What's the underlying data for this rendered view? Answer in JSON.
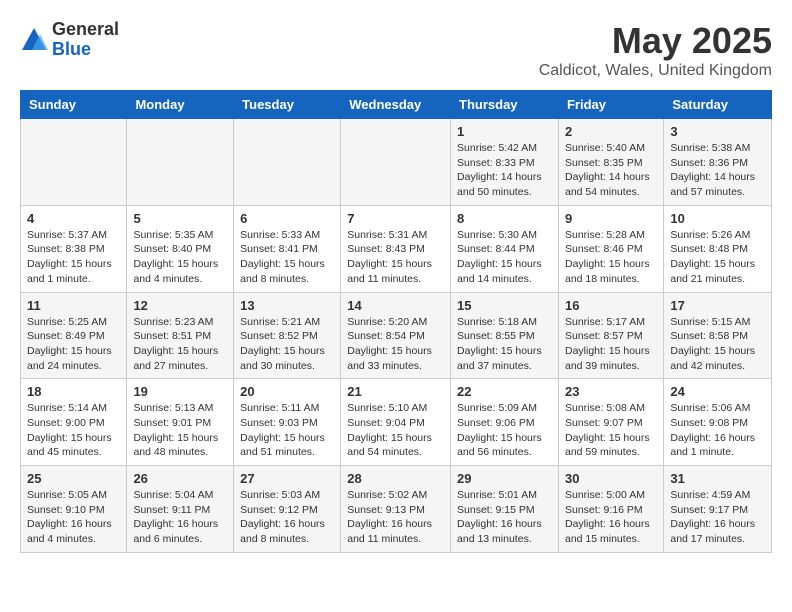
{
  "logo": {
    "general": "General",
    "blue": "Blue"
  },
  "title": "May 2025",
  "location": "Caldicot, Wales, United Kingdom",
  "headers": [
    "Sunday",
    "Monday",
    "Tuesday",
    "Wednesday",
    "Thursday",
    "Friday",
    "Saturday"
  ],
  "weeks": [
    [
      {
        "day": "",
        "info": ""
      },
      {
        "day": "",
        "info": ""
      },
      {
        "day": "",
        "info": ""
      },
      {
        "day": "",
        "info": ""
      },
      {
        "day": "1",
        "info": "Sunrise: 5:42 AM\nSunset: 8:33 PM\nDaylight: 14 hours\nand 50 minutes."
      },
      {
        "day": "2",
        "info": "Sunrise: 5:40 AM\nSunset: 8:35 PM\nDaylight: 14 hours\nand 54 minutes."
      },
      {
        "day": "3",
        "info": "Sunrise: 5:38 AM\nSunset: 8:36 PM\nDaylight: 14 hours\nand 57 minutes."
      }
    ],
    [
      {
        "day": "4",
        "info": "Sunrise: 5:37 AM\nSunset: 8:38 PM\nDaylight: 15 hours\nand 1 minute."
      },
      {
        "day": "5",
        "info": "Sunrise: 5:35 AM\nSunset: 8:40 PM\nDaylight: 15 hours\nand 4 minutes."
      },
      {
        "day": "6",
        "info": "Sunrise: 5:33 AM\nSunset: 8:41 PM\nDaylight: 15 hours\nand 8 minutes."
      },
      {
        "day": "7",
        "info": "Sunrise: 5:31 AM\nSunset: 8:43 PM\nDaylight: 15 hours\nand 11 minutes."
      },
      {
        "day": "8",
        "info": "Sunrise: 5:30 AM\nSunset: 8:44 PM\nDaylight: 15 hours\nand 14 minutes."
      },
      {
        "day": "9",
        "info": "Sunrise: 5:28 AM\nSunset: 8:46 PM\nDaylight: 15 hours\nand 18 minutes."
      },
      {
        "day": "10",
        "info": "Sunrise: 5:26 AM\nSunset: 8:48 PM\nDaylight: 15 hours\nand 21 minutes."
      }
    ],
    [
      {
        "day": "11",
        "info": "Sunrise: 5:25 AM\nSunset: 8:49 PM\nDaylight: 15 hours\nand 24 minutes."
      },
      {
        "day": "12",
        "info": "Sunrise: 5:23 AM\nSunset: 8:51 PM\nDaylight: 15 hours\nand 27 minutes."
      },
      {
        "day": "13",
        "info": "Sunrise: 5:21 AM\nSunset: 8:52 PM\nDaylight: 15 hours\nand 30 minutes."
      },
      {
        "day": "14",
        "info": "Sunrise: 5:20 AM\nSunset: 8:54 PM\nDaylight: 15 hours\nand 33 minutes."
      },
      {
        "day": "15",
        "info": "Sunrise: 5:18 AM\nSunset: 8:55 PM\nDaylight: 15 hours\nand 37 minutes."
      },
      {
        "day": "16",
        "info": "Sunrise: 5:17 AM\nSunset: 8:57 PM\nDaylight: 15 hours\nand 39 minutes."
      },
      {
        "day": "17",
        "info": "Sunrise: 5:15 AM\nSunset: 8:58 PM\nDaylight: 15 hours\nand 42 minutes."
      }
    ],
    [
      {
        "day": "18",
        "info": "Sunrise: 5:14 AM\nSunset: 9:00 PM\nDaylight: 15 hours\nand 45 minutes."
      },
      {
        "day": "19",
        "info": "Sunrise: 5:13 AM\nSunset: 9:01 PM\nDaylight: 15 hours\nand 48 minutes."
      },
      {
        "day": "20",
        "info": "Sunrise: 5:11 AM\nSunset: 9:03 PM\nDaylight: 15 hours\nand 51 minutes."
      },
      {
        "day": "21",
        "info": "Sunrise: 5:10 AM\nSunset: 9:04 PM\nDaylight: 15 hours\nand 54 minutes."
      },
      {
        "day": "22",
        "info": "Sunrise: 5:09 AM\nSunset: 9:06 PM\nDaylight: 15 hours\nand 56 minutes."
      },
      {
        "day": "23",
        "info": "Sunrise: 5:08 AM\nSunset: 9:07 PM\nDaylight: 15 hours\nand 59 minutes."
      },
      {
        "day": "24",
        "info": "Sunrise: 5:06 AM\nSunset: 9:08 PM\nDaylight: 16 hours\nand 1 minute."
      }
    ],
    [
      {
        "day": "25",
        "info": "Sunrise: 5:05 AM\nSunset: 9:10 PM\nDaylight: 16 hours\nand 4 minutes."
      },
      {
        "day": "26",
        "info": "Sunrise: 5:04 AM\nSunset: 9:11 PM\nDaylight: 16 hours\nand 6 minutes."
      },
      {
        "day": "27",
        "info": "Sunrise: 5:03 AM\nSunset: 9:12 PM\nDaylight: 16 hours\nand 8 minutes."
      },
      {
        "day": "28",
        "info": "Sunrise: 5:02 AM\nSunset: 9:13 PM\nDaylight: 16 hours\nand 11 minutes."
      },
      {
        "day": "29",
        "info": "Sunrise: 5:01 AM\nSunset: 9:15 PM\nDaylight: 16 hours\nand 13 minutes."
      },
      {
        "day": "30",
        "info": "Sunrise: 5:00 AM\nSunset: 9:16 PM\nDaylight: 16 hours\nand 15 minutes."
      },
      {
        "day": "31",
        "info": "Sunrise: 4:59 AM\nSunset: 9:17 PM\nDaylight: 16 hours\nand 17 minutes."
      }
    ]
  ]
}
